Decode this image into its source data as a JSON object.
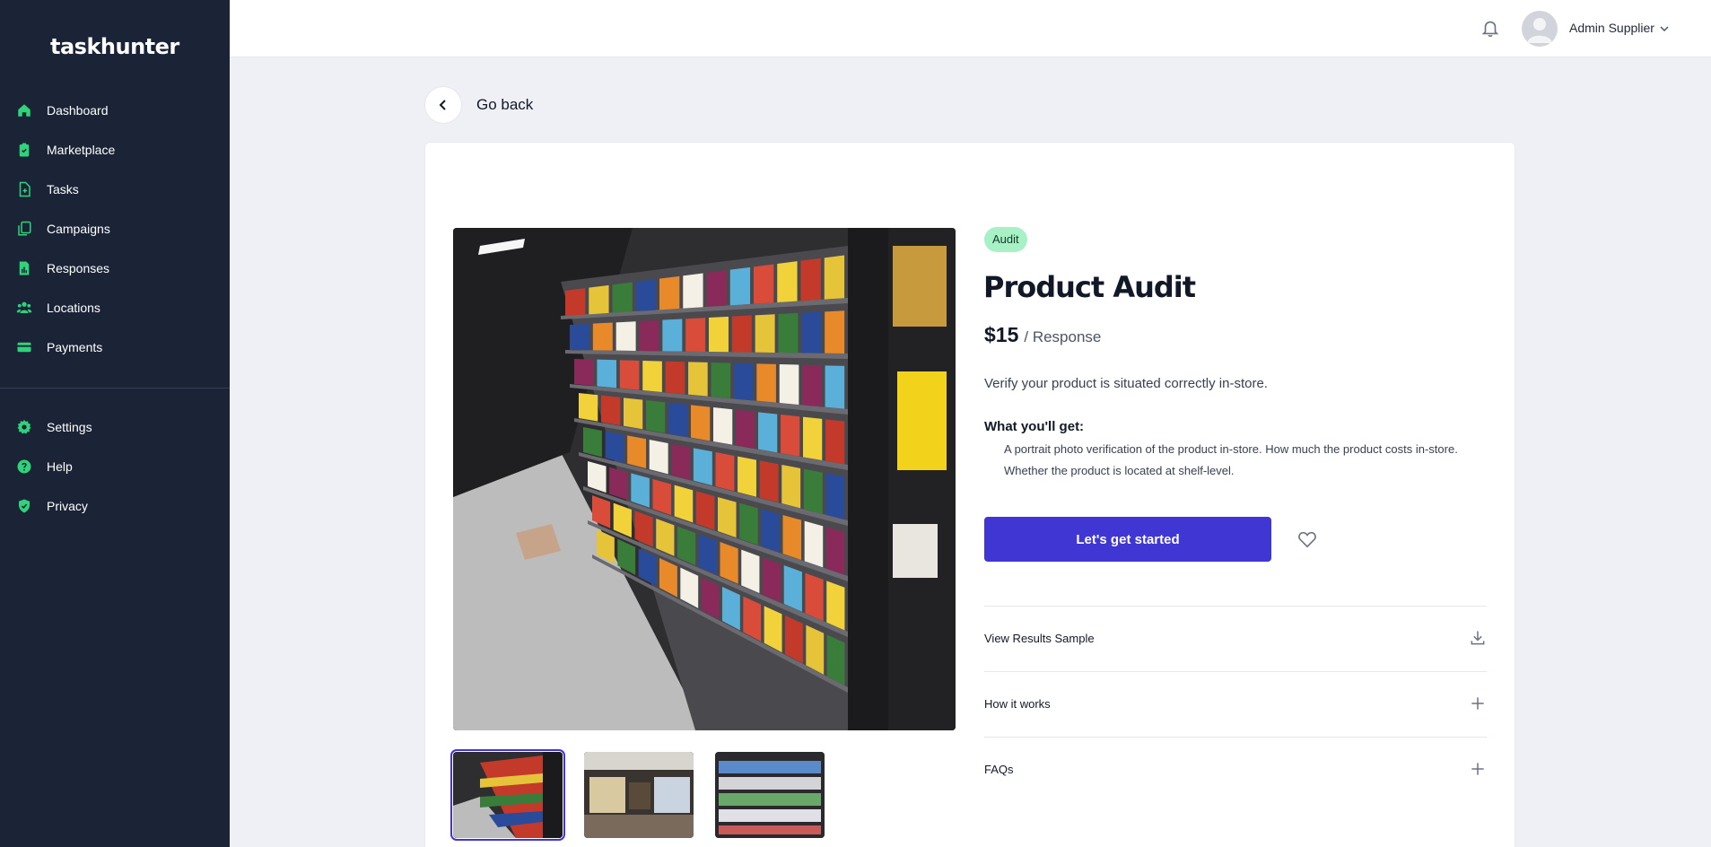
{
  "app": {
    "logo": "taskhunter"
  },
  "sidebar": {
    "main_items": [
      {
        "label": "Dashboard",
        "icon": "home-icon"
      },
      {
        "label": "Marketplace",
        "icon": "clipboard-icon"
      },
      {
        "label": "Tasks",
        "icon": "file-plus-icon"
      },
      {
        "label": "Campaigns",
        "icon": "copy-icon"
      },
      {
        "label": "Responses",
        "icon": "bar-chart-icon"
      },
      {
        "label": "Locations",
        "icon": "users-icon"
      },
      {
        "label": "Payments",
        "icon": "credit-card-icon"
      }
    ],
    "secondary_items": [
      {
        "label": "Settings",
        "icon": "gear-icon"
      },
      {
        "label": "Help",
        "icon": "help-circle-icon"
      },
      {
        "label": "Privacy",
        "icon": "shield-check-icon"
      }
    ],
    "icon_color": "#2fd37a"
  },
  "header": {
    "user_name": "Admin Supplier"
  },
  "nav": {
    "back_label": "Go back"
  },
  "product": {
    "badge": "Audit",
    "title": "Product Audit",
    "price": "$15",
    "price_unit": "/ Response",
    "description": "Verify your product is situated correctly in-store.",
    "what_you_get_title": "What you'll get:",
    "what_you_get_line1": "A portrait photo verification of the product in-store. How much the product costs in-store.",
    "what_you_get_line2": "Whether the product is located at shelf-level.",
    "cta_label": "Let's get started",
    "thumbnail_count": 3,
    "active_thumbnail": 1
  },
  "accordion": [
    {
      "label": "View Results Sample",
      "icon": "download-icon"
    },
    {
      "label": "How it works",
      "icon": "plus-icon"
    },
    {
      "label": "FAQs",
      "icon": "plus-icon"
    }
  ],
  "colors": {
    "sidebar_bg": "#1b2436",
    "accent": "#3f36d4",
    "badge_bg": "#a8f0c6",
    "nav_icon": "#2fd37a",
    "page_bg": "#eef0f5"
  }
}
